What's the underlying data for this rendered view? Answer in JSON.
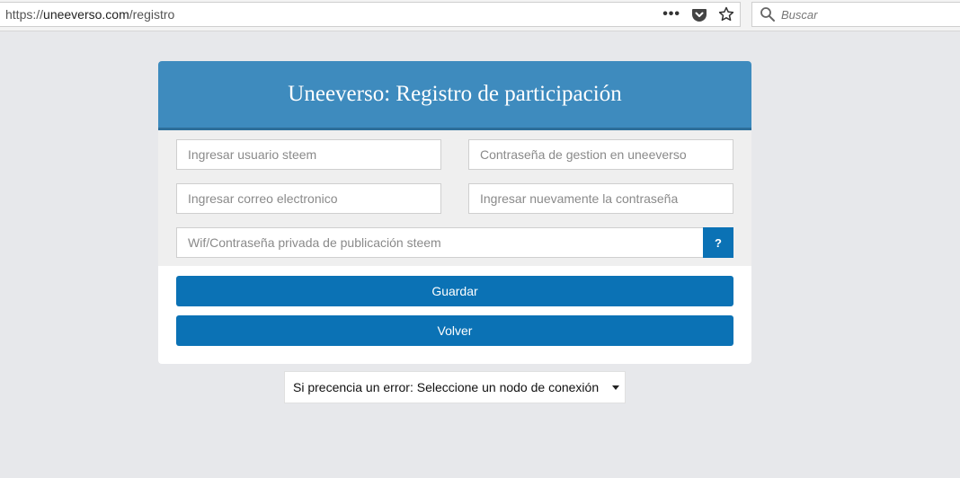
{
  "browser": {
    "url_prefix": "https://",
    "url_host": "uneeverso.com",
    "url_path": "/registro",
    "menu_dots": "•••",
    "search_placeholder": "Buscar"
  },
  "form": {
    "title": "Uneeverso: Registro de participación",
    "fields": {
      "steem_user": "Ingresar usuario steem",
      "mgmt_password": "Contraseña de gestion en uneeverso",
      "email": "Ingresar correo electronico",
      "password_repeat": "Ingresar nuevamente la contraseña",
      "wif_key": "Wif/Contraseña privada de publicación steem"
    },
    "help_label": "?",
    "save_label": "Guardar",
    "back_label": "Volver"
  },
  "node_select": {
    "selected": "Si precencia un error: Seleccione un nodo de conexión"
  },
  "colors": {
    "header": "#3e8bbe",
    "button": "#0b72b5",
    "background": "#e7e8eb"
  }
}
